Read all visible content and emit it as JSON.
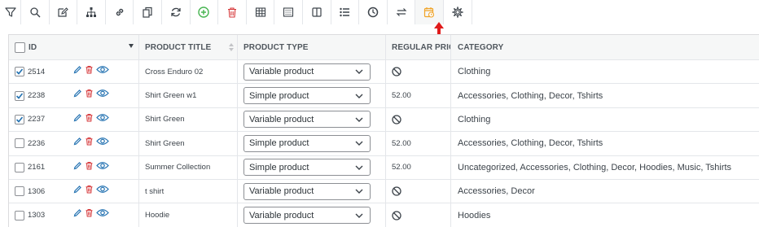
{
  "toolbar": {
    "buttons": [
      {
        "icon": "filter-icon"
      },
      {
        "icon": "search-icon"
      },
      {
        "icon": "bulk-edit-icon"
      },
      {
        "icon": "sitemap-icon"
      },
      {
        "icon": "link-icon"
      },
      {
        "icon": "duplicate-icon"
      },
      {
        "icon": "refresh-icon"
      },
      {
        "icon": "add-icon"
      },
      {
        "icon": "trash-icon"
      },
      {
        "icon": "table-icon"
      },
      {
        "icon": "spreadsheet-icon"
      },
      {
        "icon": "columns-icon"
      },
      {
        "icon": "list-icon"
      },
      {
        "icon": "history-icon"
      },
      {
        "icon": "swap-icon"
      },
      {
        "icon": "schedule-icon"
      },
      {
        "icon": "gear-icon"
      }
    ],
    "highlight_color": "#f0a326",
    "add_color": "#46b450",
    "trash_color": "#d63638"
  },
  "table": {
    "columns": {
      "id": "ID",
      "title": "PRODUCT TITLE",
      "type": "PRODUCT TYPE",
      "price": "REGULAR PRICE",
      "category": "CATEGORY"
    },
    "rows": [
      {
        "checked": true,
        "id": "2514",
        "title": "Cross Enduro 02",
        "type": "Variable product",
        "price": "",
        "price_blocked": true,
        "category": "Clothing"
      },
      {
        "checked": true,
        "id": "2238",
        "title": "Shirt Green w1",
        "type": "Simple product",
        "price": "52.00",
        "price_blocked": false,
        "category": "Accessories, Clothing, Decor, Tshirts"
      },
      {
        "checked": true,
        "id": "2237",
        "title": "Shirt Green",
        "type": "Variable product",
        "price": "",
        "price_blocked": true,
        "category": "Clothing"
      },
      {
        "checked": false,
        "id": "2236",
        "title": "Shirt Green",
        "type": "Simple product",
        "price": "52.00",
        "price_blocked": false,
        "category": "Accessories, Clothing, Decor, Tshirts"
      },
      {
        "checked": false,
        "id": "2161",
        "title": "Summer Collection",
        "type": "Simple product",
        "price": "52.00",
        "price_blocked": false,
        "category": "Uncategorized, Accessories, Clothing, Decor, Hoodies, Music, Tshirts"
      },
      {
        "checked": false,
        "id": "1306",
        "title": "t shirt",
        "type": "Variable product",
        "price": "",
        "price_blocked": true,
        "category": "Accessories, Decor"
      },
      {
        "checked": false,
        "id": "1303",
        "title": "Hoodie",
        "type": "Variable product",
        "price": "",
        "price_blocked": true,
        "category": "Hoodies"
      }
    ],
    "accent_color": "#2271b1",
    "delete_color": "#d63638"
  }
}
